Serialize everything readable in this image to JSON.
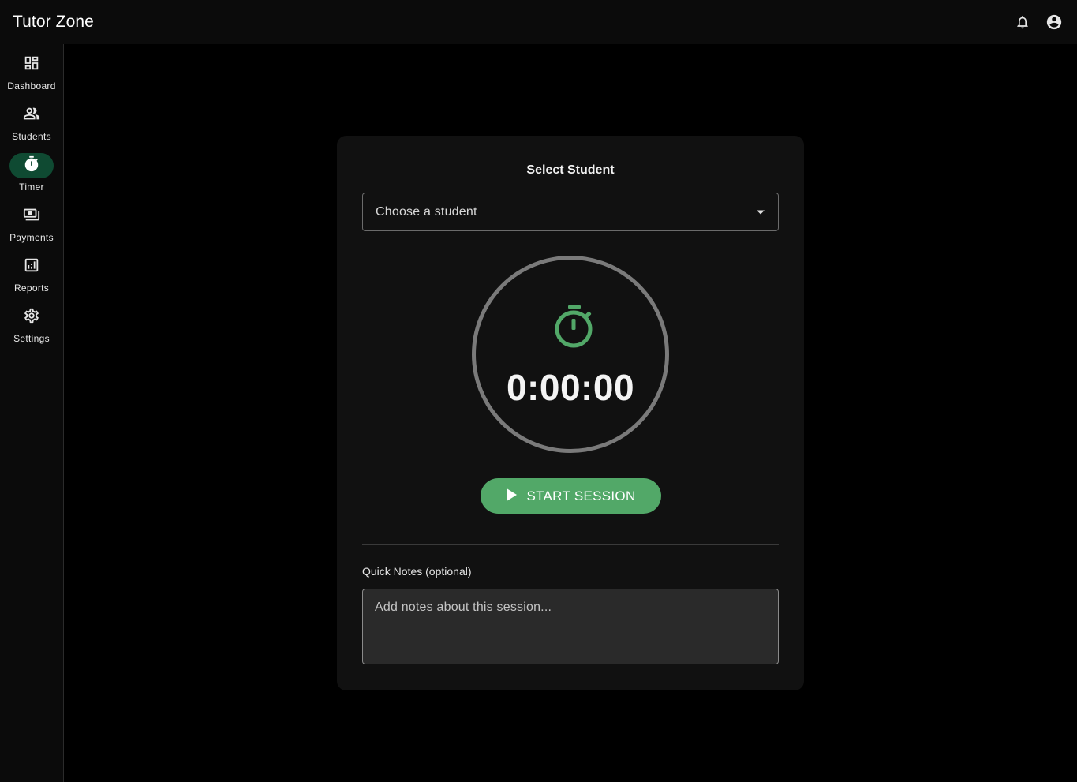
{
  "app": {
    "title": "Tutor Zone"
  },
  "topbar": {
    "icons": [
      "bell-icon",
      "account-circle-icon"
    ]
  },
  "sidebar": {
    "items": [
      {
        "label": "Dashboard",
        "icon": "dashboard-icon",
        "active": false
      },
      {
        "label": "Students",
        "icon": "people-icon",
        "active": false
      },
      {
        "label": "Timer",
        "icon": "timer-icon",
        "active": true
      },
      {
        "label": "Payments",
        "icon": "payments-icon",
        "active": false
      },
      {
        "label": "Reports",
        "icon": "reports-icon",
        "active": false
      },
      {
        "label": "Settings",
        "icon": "settings-icon",
        "active": false
      }
    ]
  },
  "timer_card": {
    "select_title": "Select Student",
    "student_select": {
      "value": "Choose a student",
      "icon": "arrow-drop-down-icon"
    },
    "timer_icon": "timer-icon",
    "timer_display": "0:00:00",
    "start_button": {
      "label": "START SESSION",
      "icon": "play-icon"
    },
    "notes_label": "Quick Notes (optional)",
    "notes_placeholder": "Add notes about this session..."
  },
  "colors": {
    "background": "#000000",
    "surface": "#111111",
    "accent_green": "#52a868",
    "active_nav": "#0f4a32",
    "ring": "#7a7a7a"
  }
}
